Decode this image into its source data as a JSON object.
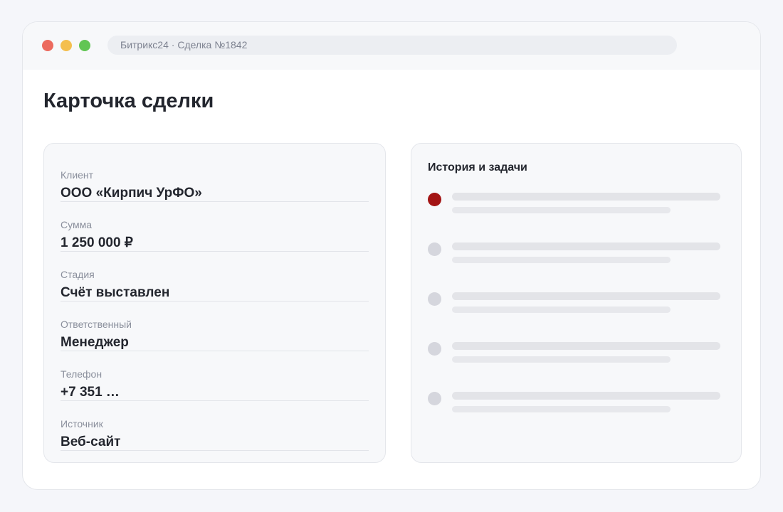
{
  "window": {
    "address_text": "Битрикс24 · Сделка №1842",
    "controls": {
      "close_color": "#ec6a5e",
      "minimize_color": "#f4bf4f",
      "maximize_color": "#61c554"
    }
  },
  "page": {
    "title": "Карточка сделки"
  },
  "deal": {
    "fields": [
      {
        "label": "Клиент",
        "value": "ООО «Кирпич УрФО»"
      },
      {
        "label": "Сумма",
        "value": "1 250 000 ₽"
      },
      {
        "label": "Стадия",
        "value": "Счёт выставлен"
      },
      {
        "label": "Ответственный",
        "value": "Менеджер"
      },
      {
        "label": "Телефон",
        "value": "+7 351 …"
      },
      {
        "label": "Источник",
        "value": "Веб-сайт"
      }
    ]
  },
  "history": {
    "title": "История и задачи",
    "items": [
      {
        "status": "active",
        "marker_color": "#a31414"
      },
      {
        "status": "inactive",
        "marker_color": "#d5d6dd"
      },
      {
        "status": "inactive",
        "marker_color": "#d5d6dd"
      },
      {
        "status": "inactive",
        "marker_color": "#d5d6dd"
      },
      {
        "status": "inactive",
        "marker_color": "#d5d6dd"
      }
    ]
  }
}
